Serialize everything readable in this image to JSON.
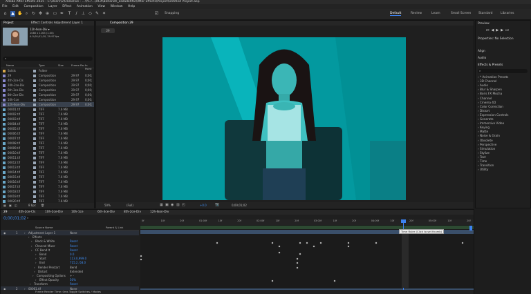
{
  "window": {
    "title": "Adobe After Effects 2025 - C:\\Users\\v\\OneDrive - ...\\Y17...\\ACX\\Behaneh_alizadehfar\\After Effects\\Project\\Untitled Project.aep"
  },
  "menu": [
    "File",
    "Edit",
    "Composition",
    "Layer",
    "Effect",
    "Animation",
    "View",
    "Window",
    "Help"
  ],
  "toolbar": {
    "snapping": "Snapping"
  },
  "workspaces": [
    "Default",
    "Review",
    "Learn",
    "Small Screen",
    "Standard",
    "Libraries"
  ],
  "project_panel": {
    "tab_project": "Project",
    "tab_effect_controls": "Effect Controls Adjustment Layer 1",
    "thumb_name": "12h-Ikon-Div ▾",
    "thumb_info1": "1080 x 1163 (1.00)",
    "thumb_info2": "Δ 0;00;01;10, 29.97 fps",
    "search_placeholder": "⌕",
    "columns": [
      "Name",
      "Type",
      "Size",
      "Frame Ra...",
      "In Point"
    ],
    "rows": [
      {
        "name": "Solids",
        "type": "Folder",
        "size": "",
        "fr": "",
        "inp": ""
      },
      {
        "name": "29",
        "type": "Composition",
        "size": "",
        "fr": "29.97",
        "inp": "0;00;"
      },
      {
        "name": "4th-2ce-Cls",
        "type": "Composition",
        "size": "",
        "fr": "29.97",
        "inp": "0;00;"
      },
      {
        "name": "10h-2ce-Div",
        "type": "Composition",
        "size": "",
        "fr": "29.97",
        "inp": "0;00;"
      },
      {
        "name": "6th-3ce-Div",
        "type": "Composition",
        "size": "",
        "fr": "29.97",
        "inp": "0;00;"
      },
      {
        "name": "8th-2ce-Div",
        "type": "Composition",
        "size": "",
        "fr": "29.97",
        "inp": "0;00;"
      },
      {
        "name": "10h-1ce",
        "type": "Composition",
        "size": "",
        "fr": "29.97",
        "inp": "0;00;"
      },
      {
        "name": "12h-Ikon-Div",
        "type": "Composition",
        "size": "",
        "fr": "29.97",
        "inp": "0;00;"
      },
      {
        "name": "00001.tif",
        "type": "TIFF",
        "size": "7.6 MB",
        "fr": "",
        "inp": ""
      },
      {
        "name": "00002.tif",
        "type": "TIFF",
        "size": "7.6 MB",
        "fr": "",
        "inp": ""
      },
      {
        "name": "00003.tif",
        "type": "TIFF",
        "size": "7.6 MB",
        "fr": "",
        "inp": ""
      },
      {
        "name": "00004.tif",
        "type": "TIFF",
        "size": "7.6 MB",
        "fr": "",
        "inp": ""
      },
      {
        "name": "00005.tif",
        "type": "TIFF",
        "size": "7.6 MB",
        "fr": "",
        "inp": ""
      },
      {
        "name": "00006.tif",
        "type": "TIFF",
        "size": "7.6 MB",
        "fr": "",
        "inp": ""
      },
      {
        "name": "00007.tif",
        "type": "TIFF",
        "size": "7.6 MB",
        "fr": "",
        "inp": ""
      },
      {
        "name": "00008.tif",
        "type": "TIFF",
        "size": "7.6 MB",
        "fr": "",
        "inp": ""
      },
      {
        "name": "00009.tif",
        "type": "TIFF",
        "size": "7.6 MB",
        "fr": "",
        "inp": ""
      },
      {
        "name": "00010.tif",
        "type": "TIFF",
        "size": "7.6 MB",
        "fr": "",
        "inp": ""
      },
      {
        "name": "00011.tif",
        "type": "TIFF",
        "size": "7.6 MB",
        "fr": "",
        "inp": ""
      },
      {
        "name": "00012.tif",
        "type": "TIFF",
        "size": "7.6 MB",
        "fr": "",
        "inp": ""
      },
      {
        "name": "00013.tif",
        "type": "TIFF",
        "size": "7.6 MB",
        "fr": "",
        "inp": ""
      },
      {
        "name": "00014.tif",
        "type": "TIFF",
        "size": "7.6 MB",
        "fr": "",
        "inp": ""
      },
      {
        "name": "00015.tif",
        "type": "TIFF",
        "size": "7.6 MB",
        "fr": "",
        "inp": ""
      },
      {
        "name": "00016.tif",
        "type": "TIFF",
        "size": "7.6 MB",
        "fr": "",
        "inp": ""
      },
      {
        "name": "00017.tif",
        "type": "TIFF",
        "size": "7.6 MB",
        "fr": "",
        "inp": ""
      },
      {
        "name": "00018.tif",
        "type": "TIFF",
        "size": "7.6 MB",
        "fr": "",
        "inp": ""
      },
      {
        "name": "00019.tif",
        "type": "TIFF",
        "size": "7.6 MB",
        "fr": "",
        "inp": ""
      },
      {
        "name": "00020.tif",
        "type": "TIFF",
        "size": "7.6 MB",
        "fr": "",
        "inp": ""
      }
    ],
    "bpc": "8 bpc"
  },
  "composition": {
    "tab": "Composition 29",
    "sub_tab": "29",
    "zoom": "50%",
    "resolution": "(Full)",
    "timecode": "0;00;01;02",
    "exposure": "+0.0"
  },
  "right_panel": {
    "preview": "Preview",
    "properties": "Properties: No Selection",
    "align": "Align",
    "audio": "Audio",
    "effects_presets": "Effects & Presets",
    "search": "⌕",
    "categories": [
      "* Animation Presets",
      "3D Channel",
      "Audio",
      "Blur & Sharpen",
      "Boris FX Mocha",
      "Channel",
      "Cinema 4D",
      "Color Correction",
      "Distort",
      "Expression Controls",
      "Generate",
      "Immersive Video",
      "Keying",
      "Matte",
      "Noise & Grain",
      "Obsolete",
      "Perspective",
      "Simulation",
      "Stylize",
      "Text",
      "Time",
      "Transition",
      "Utility"
    ]
  },
  "timeline": {
    "tabs": [
      "29",
      "4th-2ce-Cls",
      "10h-2ce-Div",
      "10h-1ce",
      "6th-3ce-Div",
      "8th-2ce-Div",
      "12h-Ikon-Div"
    ],
    "timecode": "0;00;01;02",
    "col_source": "Source Name",
    "col_parent": "Parent & Link",
    "layers": [
      {
        "label": "1",
        "name": "Adjustment Layer 1",
        "val": "None"
      },
      {
        "label": "",
        "name": "Effects",
        "val": ""
      },
      {
        "label": "",
        "name": "Black & White",
        "val": "Reset"
      },
      {
        "label": "",
        "name": "Channel Mixer",
        "val": "Reset"
      },
      {
        "label": "",
        "name": "CC Bend It",
        "val": "Reset"
      },
      {
        "label": "",
        "name": "Bend",
        "val": "0.0"
      },
      {
        "label": "",
        "name": "Start",
        "val": "113.0,999.0"
      },
      {
        "label": "",
        "name": "End",
        "val": "715.2,-58.0"
      },
      {
        "label": "",
        "name": "Render Prestart",
        "val": "Bend"
      },
      {
        "label": "",
        "name": "Distort",
        "val": "Extended"
      },
      {
        "label": "",
        "name": "Compositing Options",
        "val": "+ -"
      },
      {
        "label": "",
        "name": "Effect Opacity",
        "val": "50%"
      },
      {
        "label": "",
        "name": "Transform",
        "val": "Reset"
      },
      {
        "label": "2",
        "name": "00001.tif",
        "val": "None"
      }
    ],
    "ruler": [
      "0f",
      "10f",
      "20f",
      "01:00f",
      "10f",
      "20f",
      "02:00f",
      "10f",
      "20f",
      "03:00f",
      "10f",
      "20f",
      "04:00f",
      "10f",
      "20f",
      "05:00f",
      "10f",
      "20f"
    ],
    "tooltip": "Time Ruler (Click to set thumb)",
    "footer": "Frame Render Time: 0ms   Toggle Switches / Modes"
  },
  "colors": {
    "teal": "#00aeb8",
    "accent": "#3c82f0",
    "bg": "#1d1d1d"
  }
}
